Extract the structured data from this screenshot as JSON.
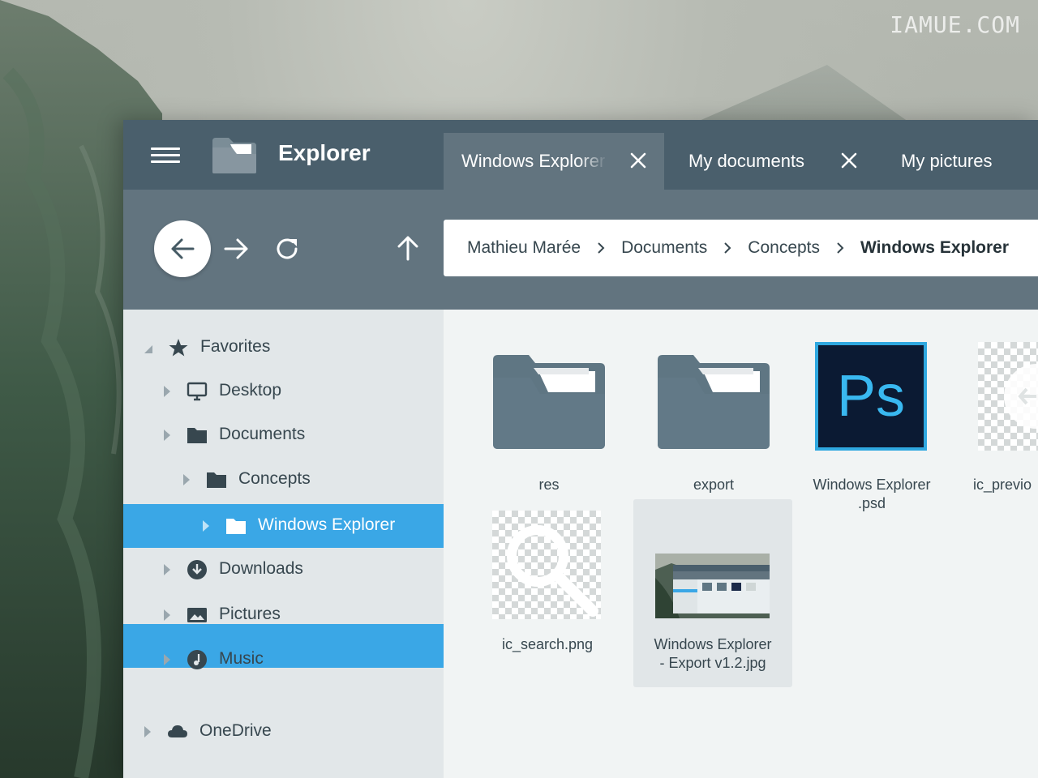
{
  "watermark": "IAMUE.COM",
  "app": {
    "title": "Explorer"
  },
  "tabs": [
    {
      "label": "Windows Explorer",
      "active": true,
      "closable": true
    },
    {
      "label": "My documents",
      "active": false,
      "closable": true
    },
    {
      "label": "My pictures",
      "active": false,
      "closable": false
    }
  ],
  "breadcrumb": [
    "Mathieu Marée",
    "Documents",
    "Concepts",
    "Windows Explorer"
  ],
  "sidebar": {
    "items": [
      {
        "label": "Favorites",
        "icon": "star-icon",
        "expanded": true
      },
      {
        "label": "Desktop",
        "icon": "monitor-icon"
      },
      {
        "label": "Documents",
        "icon": "folder-icon"
      },
      {
        "label": "Concepts",
        "icon": "folder-icon"
      },
      {
        "label": "Windows Explorer",
        "icon": "folder-icon",
        "selected": true
      },
      {
        "label": "Downloads",
        "icon": "download-icon"
      },
      {
        "label": "Pictures",
        "icon": "image-icon"
      },
      {
        "label": "Music",
        "icon": "music-icon"
      },
      {
        "label": "OneDrive",
        "icon": "cloud-icon"
      }
    ]
  },
  "files": [
    {
      "name": "res",
      "type": "folder"
    },
    {
      "name": "export",
      "type": "folder"
    },
    {
      "name_line1": "Windows Explorer",
      "name_line2": ".psd",
      "type": "psd",
      "icon_text": "Ps"
    },
    {
      "name": "ic_previo",
      "type": "png"
    },
    {
      "name": "ic_search.png",
      "type": "png"
    },
    {
      "name_line1": "Windows Explorer",
      "name_line2": "- Export v1.2.jpg",
      "type": "jpg",
      "selected": true
    }
  ],
  "colors": {
    "titlebar": "#4a5f6c",
    "toolbar": "#62747f",
    "accent": "#3aa7e6",
    "sidebar": "#e2e7e9",
    "content": "#f1f4f4"
  }
}
